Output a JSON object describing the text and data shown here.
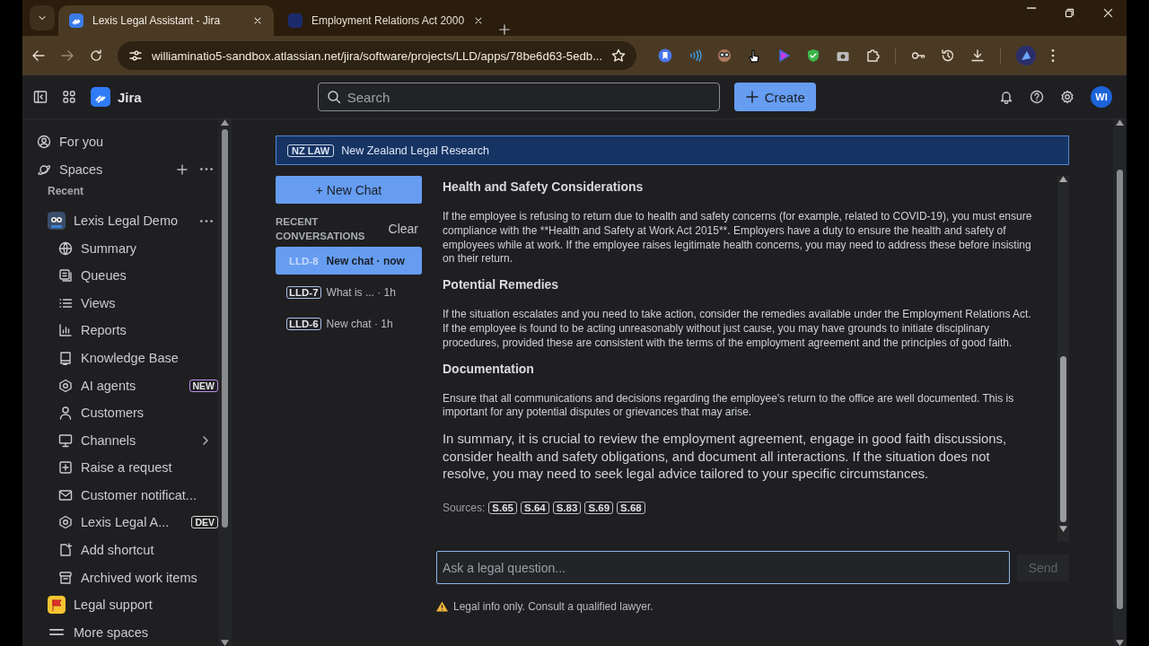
{
  "browser": {
    "tabs": [
      {
        "title": "Lexis Legal Assistant - Jira",
        "selected": true
      },
      {
        "title": "Employment Relations Act 2000",
        "selected": false
      }
    ],
    "url": "williaminatio5-sandbox.atlassian.net/jira/software/projects/LLD/apps/78be6d63-5edb..."
  },
  "topbar": {
    "product": "Jira",
    "search_placeholder": "Search",
    "create_label": "Create",
    "avatar": "WI"
  },
  "sidebar": {
    "items": [
      {
        "label": "For you"
      },
      {
        "label": "Spaces"
      }
    ],
    "section": "Recent",
    "space": {
      "label": "Lexis Legal Demo",
      "children": [
        {
          "label": "Summary"
        },
        {
          "label": "Queues"
        },
        {
          "label": "Views"
        },
        {
          "label": "Reports"
        },
        {
          "label": "Knowledge Base"
        },
        {
          "label": "AI agents",
          "badge": "NEW",
          "color": "#c08cf0"
        },
        {
          "label": "Customers"
        },
        {
          "label": "Channels",
          "expanded": false
        },
        {
          "label": "Raise a request"
        },
        {
          "label": "Customer notificat..."
        },
        {
          "label": "Lexis Legal A...",
          "badge": "DEV",
          "color": "#d4d4d4"
        },
        {
          "label": "Add shortcut"
        },
        {
          "label": "Archived work items"
        }
      ]
    },
    "more": [
      {
        "label": "Legal support"
      },
      {
        "label": "More spaces"
      }
    ]
  },
  "banner": {
    "tag": "NZ LAW",
    "title": "New Zealand Legal Research"
  },
  "conversations": {
    "new_chat": "+ New Chat",
    "heading": "RECENT CONVERSATIONS",
    "clear": "Clear",
    "items": [
      {
        "key": "LLD-8",
        "title": "New chat · now",
        "selected": true
      },
      {
        "key": "LLD-7",
        "title": "What is ... · 1h",
        "selected": false
      },
      {
        "key": "LLD-6",
        "title": "New chat · 1h",
        "selected": false
      }
    ]
  },
  "answer": [
    {
      "kind": "heading",
      "text": "Health and Safety Considerations"
    },
    {
      "kind": "paragraph",
      "text": "If the employee is refusing to return due to health and safety concerns (for example, related to COVID-19), you must ensure compliance with the **Health and Safety at Work Act 2015**. Employers have a duty to ensure the health and safety of employees while at work. If the employee raises legitimate health concerns, you may need to address these before insisting on their return."
    },
    {
      "kind": "heading",
      "text": "Potential Remedies"
    },
    {
      "kind": "paragraph",
      "text": "If the situation escalates and you need to take action, consider the remedies available under the Employment Relations Act. If the employee is found to be acting unreasonably without just cause, you may have grounds to initiate disciplinary procedures, provided these are consistent with the terms of the employment agreement and the principles of good faith."
    },
    {
      "kind": "heading",
      "text": "Documentation"
    },
    {
      "kind": "paragraph",
      "text": "Ensure that all communications and decisions regarding the employee's return to the office are well documented. This is important for any potential disputes or grievances that may arise."
    },
    {
      "kind": "summary",
      "text": "In summary, it is crucial to review the employment agreement, engage in good faith discussions, consider health and safety obligations, and document all interactions. If the situation does not resolve, you may need to seek legal advice tailored to your specific circumstances."
    }
  ],
  "sources": {
    "label": "Sources:",
    "items": [
      "S.65",
      "S.64",
      "S.83",
      "S.69",
      "S.68"
    ]
  },
  "composer": {
    "placeholder": "Ask a legal question...",
    "send": "Send",
    "send_disabled": true
  },
  "disclaimer": "Legal info only. Consult a qualified lawyer."
}
